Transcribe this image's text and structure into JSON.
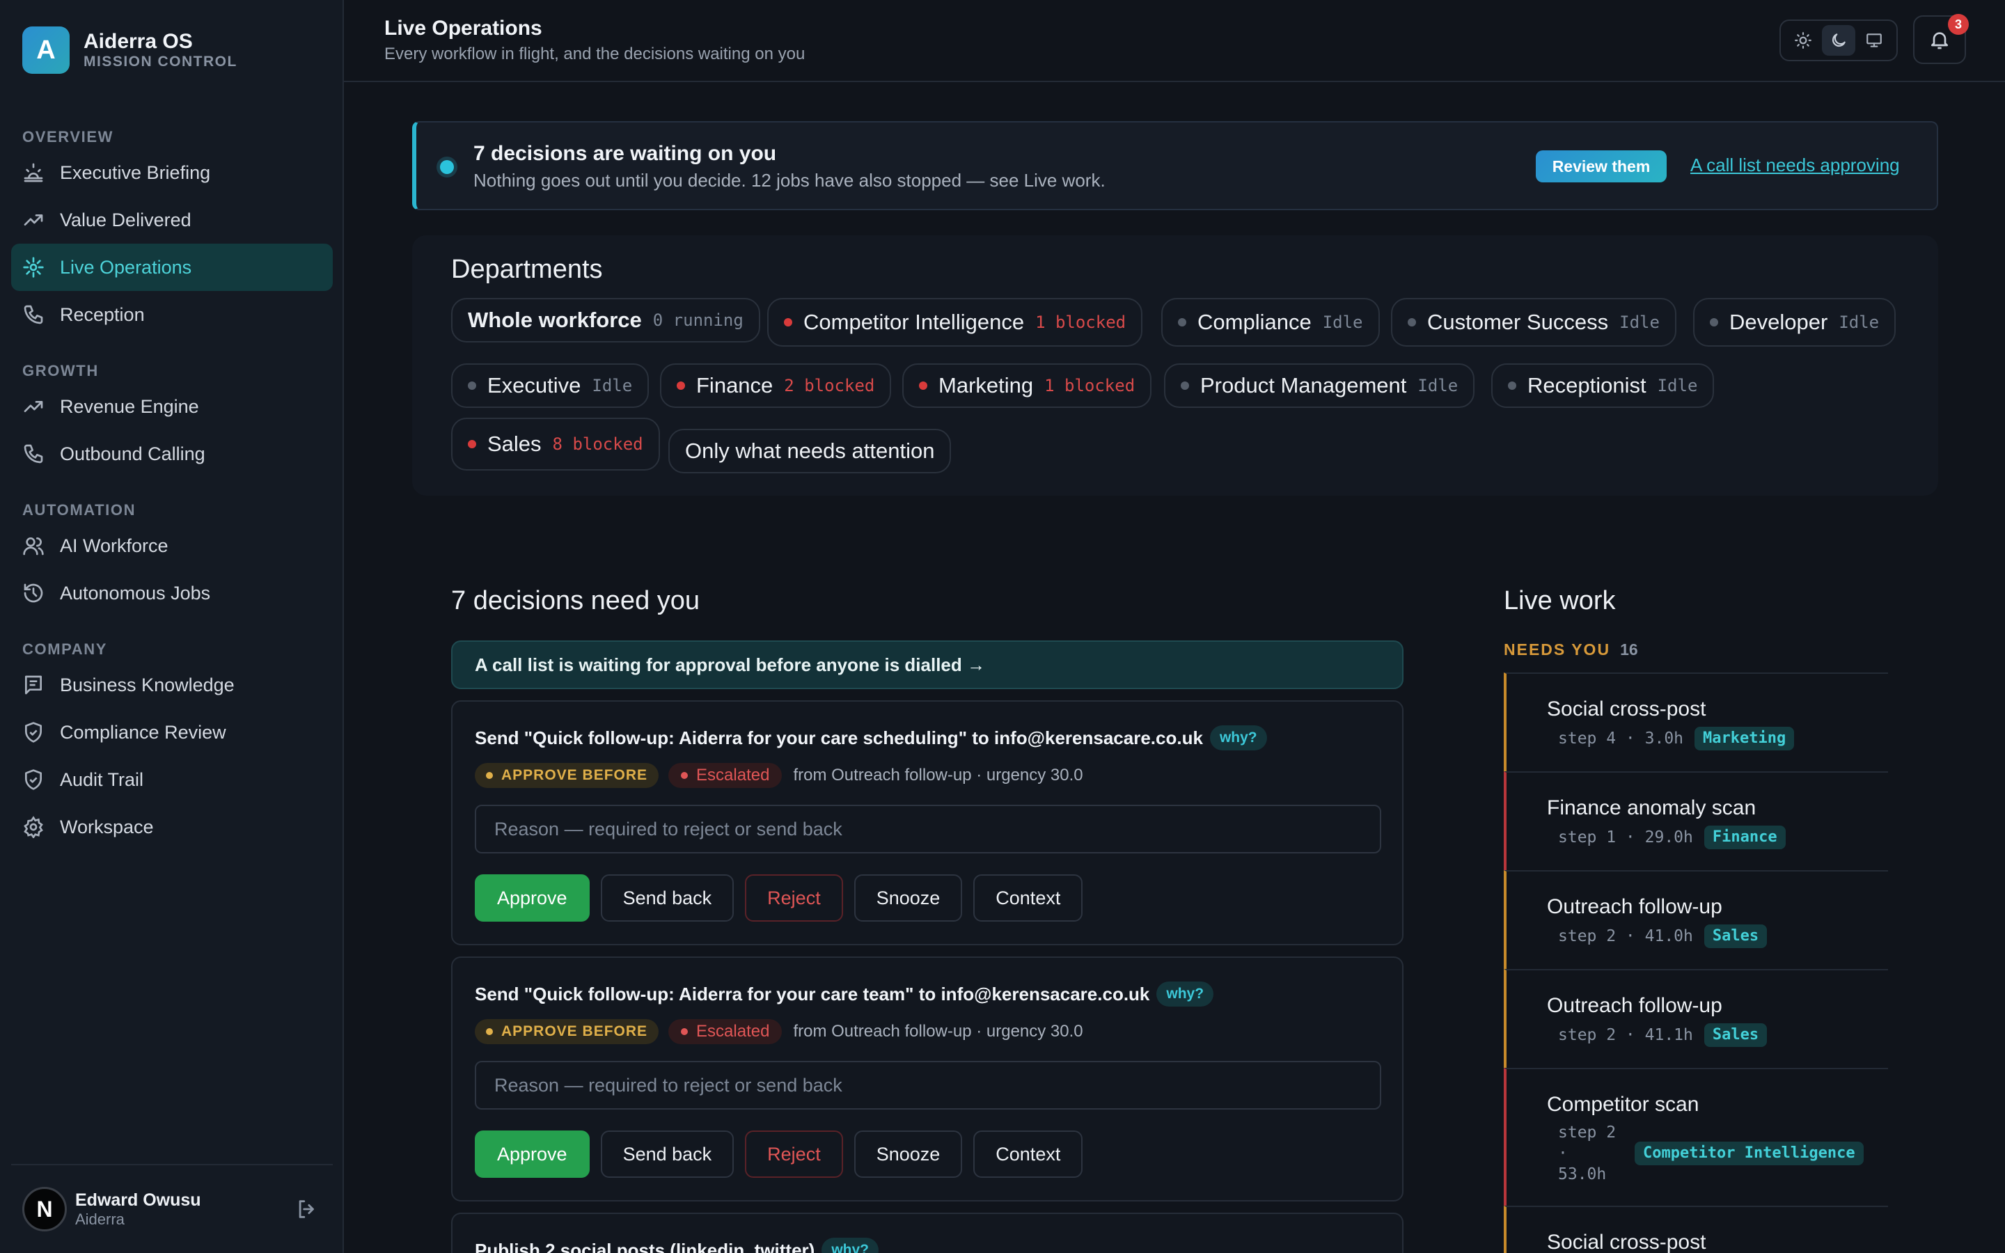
{
  "brand": {
    "logo_letter": "A",
    "name": "Aiderra OS",
    "subtitle": "MISSION CONTROL"
  },
  "sidebar": {
    "sections": [
      {
        "label": "OVERVIEW",
        "items": [
          {
            "label": "Executive Briefing",
            "icon": "sunrise-icon"
          },
          {
            "label": "Value Delivered",
            "icon": "trending-up-icon"
          },
          {
            "label": "Live Operations",
            "icon": "activity-icon",
            "active": true
          },
          {
            "label": "Reception",
            "icon": "phone-icon"
          }
        ]
      },
      {
        "label": "GROWTH",
        "items": [
          {
            "label": "Revenue Engine",
            "icon": "trending-up-icon"
          },
          {
            "label": "Outbound Calling",
            "icon": "phone-icon"
          }
        ]
      },
      {
        "label": "AUTOMATION",
        "items": [
          {
            "label": "AI Workforce",
            "icon": "users-icon"
          },
          {
            "label": "Autonomous Jobs",
            "icon": "history-icon"
          }
        ]
      },
      {
        "label": "COMPANY",
        "items": [
          {
            "label": "Business Knowledge",
            "icon": "message-square-icon"
          },
          {
            "label": "Compliance Review",
            "icon": "shield-check-icon"
          },
          {
            "label": "Audit Trail",
            "icon": "shield-check-icon"
          },
          {
            "label": "Workspace",
            "icon": "gear-icon"
          }
        ]
      }
    ],
    "user": {
      "avatar_letter": "N",
      "name": "Edward Owusu",
      "org": "Aiderra"
    }
  },
  "header": {
    "title": "Live Operations",
    "subtitle": "Every workflow in flight, and the decisions waiting on you",
    "notification_count": "3"
  },
  "banner": {
    "title": "7 decisions are waiting on you",
    "subtitle": "Nothing goes out until you decide. 12 jobs have also stopped — see Live work.",
    "button": "Review them",
    "link": "A call list needs approving"
  },
  "departments": {
    "title": "Departments",
    "chips": [
      {
        "name": "Whole workforce",
        "status": "0 running",
        "dot": "none",
        "bold": true
      },
      {
        "name": "Competitor Intelligence",
        "status": "1 blocked",
        "dot": "red"
      },
      {
        "name": "Compliance",
        "status": "Idle",
        "dot": "grey"
      },
      {
        "name": "Customer Success",
        "status": "Idle",
        "dot": "grey"
      },
      {
        "name": "Developer",
        "status": "Idle",
        "dot": "grey"
      },
      {
        "name": "Executive",
        "status": "Idle",
        "dot": "grey"
      },
      {
        "name": "Finance",
        "status": "2 blocked",
        "dot": "red"
      },
      {
        "name": "Marketing",
        "status": "1 blocked",
        "dot": "red"
      },
      {
        "name": "Product Management",
        "status": "Idle",
        "dot": "grey"
      },
      {
        "name": "Receptionist",
        "status": "Idle",
        "dot": "grey"
      },
      {
        "name": "Sales",
        "status": "8 blocked",
        "dot": "red"
      },
      {
        "name": "Only what needs attention",
        "status": "",
        "dot": "none"
      }
    ]
  },
  "decisions": {
    "title": "7 decisions need you",
    "callout": "A call list is waiting for approval before anyone is dialled →",
    "reason_placeholder": "Reason — required to reject or send back",
    "why_label": "why?",
    "approve_before_label": "APPROVE BEFORE",
    "escalated_label": "Escalated",
    "buttons": {
      "approve": "Approve",
      "send_back": "Send back",
      "reject": "Reject",
      "snooze": "Snooze",
      "context": "Context"
    },
    "items": [
      {
        "title": "Send \"Quick follow-up: Aiderra for your care scheduling\" to info@kerensacare.co.uk",
        "from": "from Outreach follow-up · urgency 30.0"
      },
      {
        "title": "Send \"Quick follow-up: Aiderra for your care team\" to info@kerensacare.co.uk",
        "from": "from Outreach follow-up · urgency 30.0"
      },
      {
        "title": "Publish 2 social posts (linkedin, twitter)",
        "from": ""
      }
    ]
  },
  "live_work": {
    "title": "Live work",
    "needs_you_label": "NEEDS YOU",
    "needs_you_count": "16",
    "items": [
      {
        "name": "Social cross-post",
        "step": "step 4 · 3.0h",
        "tag": "Marketing",
        "accent": "amber"
      },
      {
        "name": "Finance anomaly scan",
        "step": "step 1 · 29.0h",
        "tag": "Finance",
        "accent": "red"
      },
      {
        "name": "Outreach follow-up",
        "step": "step 2 · 41.0h",
        "tag": "Sales",
        "accent": "amber"
      },
      {
        "name": "Outreach follow-up",
        "step": "step 2 · 41.1h",
        "tag": "Sales",
        "accent": "amber"
      },
      {
        "name": "Competitor scan",
        "step": "step 2 · 53.0h",
        "tag": "Competitor Intelligence",
        "accent": "red"
      },
      {
        "name": "Social cross-post",
        "step": "",
        "tag": "",
        "accent": "amber"
      }
    ]
  },
  "colors": {
    "accent": "#3cc8d8",
    "approve": "#25a04e",
    "danger": "#e05656",
    "warning": "#d89a3a",
    "background": "#10141b"
  }
}
